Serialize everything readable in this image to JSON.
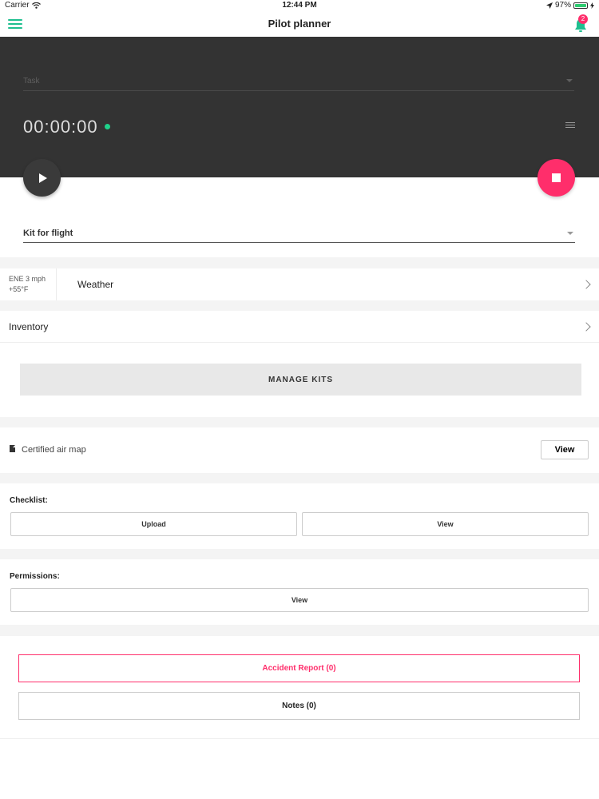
{
  "status_bar": {
    "carrier": "Carrier",
    "time": "12:44 PM",
    "battery_text": "97%",
    "battery_level": 0.97,
    "icons": [
      "wifi-icon",
      "location-arrow-icon",
      "battery-icon",
      "charging-icon"
    ]
  },
  "nav": {
    "title": "Pilot planner",
    "notification_count": "2",
    "icons": [
      "menu-icon",
      "bell-icon"
    ]
  },
  "flight_panel": {
    "task_placeholder": "Task",
    "timer": "00:00:00",
    "status_color": "#1fd18a",
    "icons": [
      "list-icon",
      "play-icon",
      "stop-icon"
    ]
  },
  "kit": {
    "selected": "Kit for flight"
  },
  "weather": {
    "wind": "ENE 3 mph",
    "temperature": "+55°F",
    "label": "Weather"
  },
  "inventory": {
    "label": "Inventory",
    "manage_label": "MANAGE KITS"
  },
  "air_map": {
    "label": "Certified air map",
    "view_label": "View",
    "icon": "document-icon"
  },
  "checklist": {
    "label": "Checklist:",
    "upload_label": "Upload",
    "view_label": "View"
  },
  "permissions": {
    "label": "Permissions:",
    "view_label": "View"
  },
  "reports": {
    "accident_label": "Accident Report (0)",
    "notes_label": "Notes (0)"
  },
  "colors": {
    "accent": "#1fbf8f",
    "danger": "#ff2e6b",
    "dark_panel": "#333333"
  }
}
